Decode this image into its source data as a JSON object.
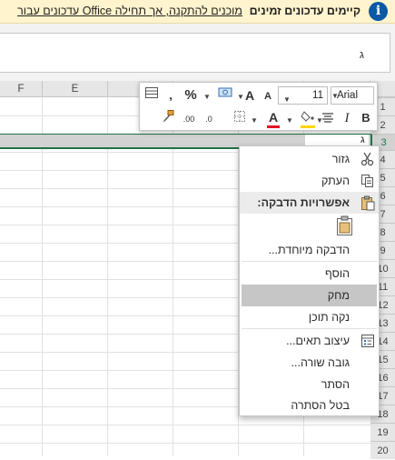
{
  "banner": {
    "title": "קיימים עדכונים זמינים",
    "link": "עדכונים עבור Office מוכנים להתקנה, אך תחילה",
    "info_icon": "info-icon",
    "bg_color": "#fff4ce",
    "icon_color": "#0c5aa6"
  },
  "formula_bar": {
    "value": "ג"
  },
  "grid": {
    "columns": [
      "F",
      "E"
    ],
    "rows": [
      "1",
      "2",
      "3",
      "4",
      "5",
      "6",
      "7",
      "8",
      "9",
      "10",
      "11",
      "12",
      "13",
      "14",
      "15",
      "16",
      "17",
      "18",
      "19",
      "20"
    ],
    "selected_row": "3",
    "selected_cell_value": "ג",
    "accent_color": "#217346"
  },
  "mini_toolbar": {
    "font": "Arial",
    "size": "11",
    "grow_font": "A",
    "shrink_font": "A",
    "percent": "%",
    "comma": ",",
    "bold": "B",
    "italic": "I",
    "font_color_letter": "A",
    "font_color": "#e81123",
    "fill_color": "#ffd700",
    "inc_decimal": ".00",
    "dec_decimal": ".0"
  },
  "context_menu": {
    "cut": "גזור",
    "copy": "העתק",
    "paste_header": "אפשרויות הדבקה:",
    "paste_special": "הדבקה מיוחדת...",
    "insert": "הוסף",
    "delete": "מחק",
    "clear_contents": "נקה תוכן",
    "format_cells": "עיצוב תאים...",
    "row_height": "גובה שורה...",
    "hide": "הסתר",
    "unhide": "בטל הסתרה"
  }
}
